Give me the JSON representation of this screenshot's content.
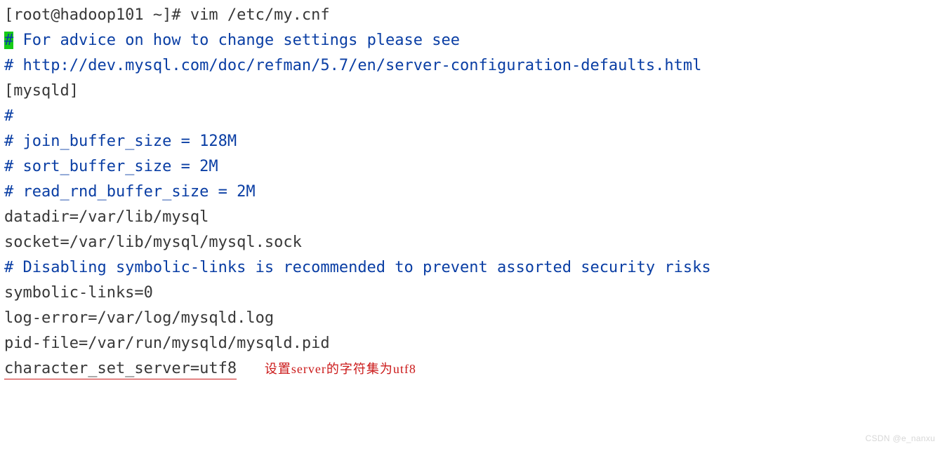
{
  "terminal": {
    "prompt": "[root@hadoop101 ~]# ",
    "command": "vim /etc/my.cnf",
    "blank1": "",
    "cursor_char": "#",
    "comment1_rest": " For advice on how to change settings please see",
    "comment2": "# http://dev.mysql.com/doc/refman/5.7/en/server-configuration-defaults.html",
    "section": "[mysqld]",
    "comment3": "#",
    "comment4": "# join_buffer_size = 128M",
    "comment5": "# sort_buffer_size = 2M",
    "comment6": "# read_rnd_buffer_size = 2M",
    "line1": "datadir=/var/lib/mysql",
    "line2": "socket=/var/lib/mysql/mysql.sock",
    "blank2": "",
    "comment7": "# Disabling symbolic-links is recommended to prevent assorted security risks",
    "line3": "symbolic-links=0",
    "line4": "log-error=/var/log/mysqld.log",
    "line5": "pid-file=/var/run/mysqld/mysqld.pid",
    "line6": "character_set_server=utf8",
    "annotation": "设置server的字符集为utf8"
  },
  "watermark": "CSDN @e_nanxu"
}
